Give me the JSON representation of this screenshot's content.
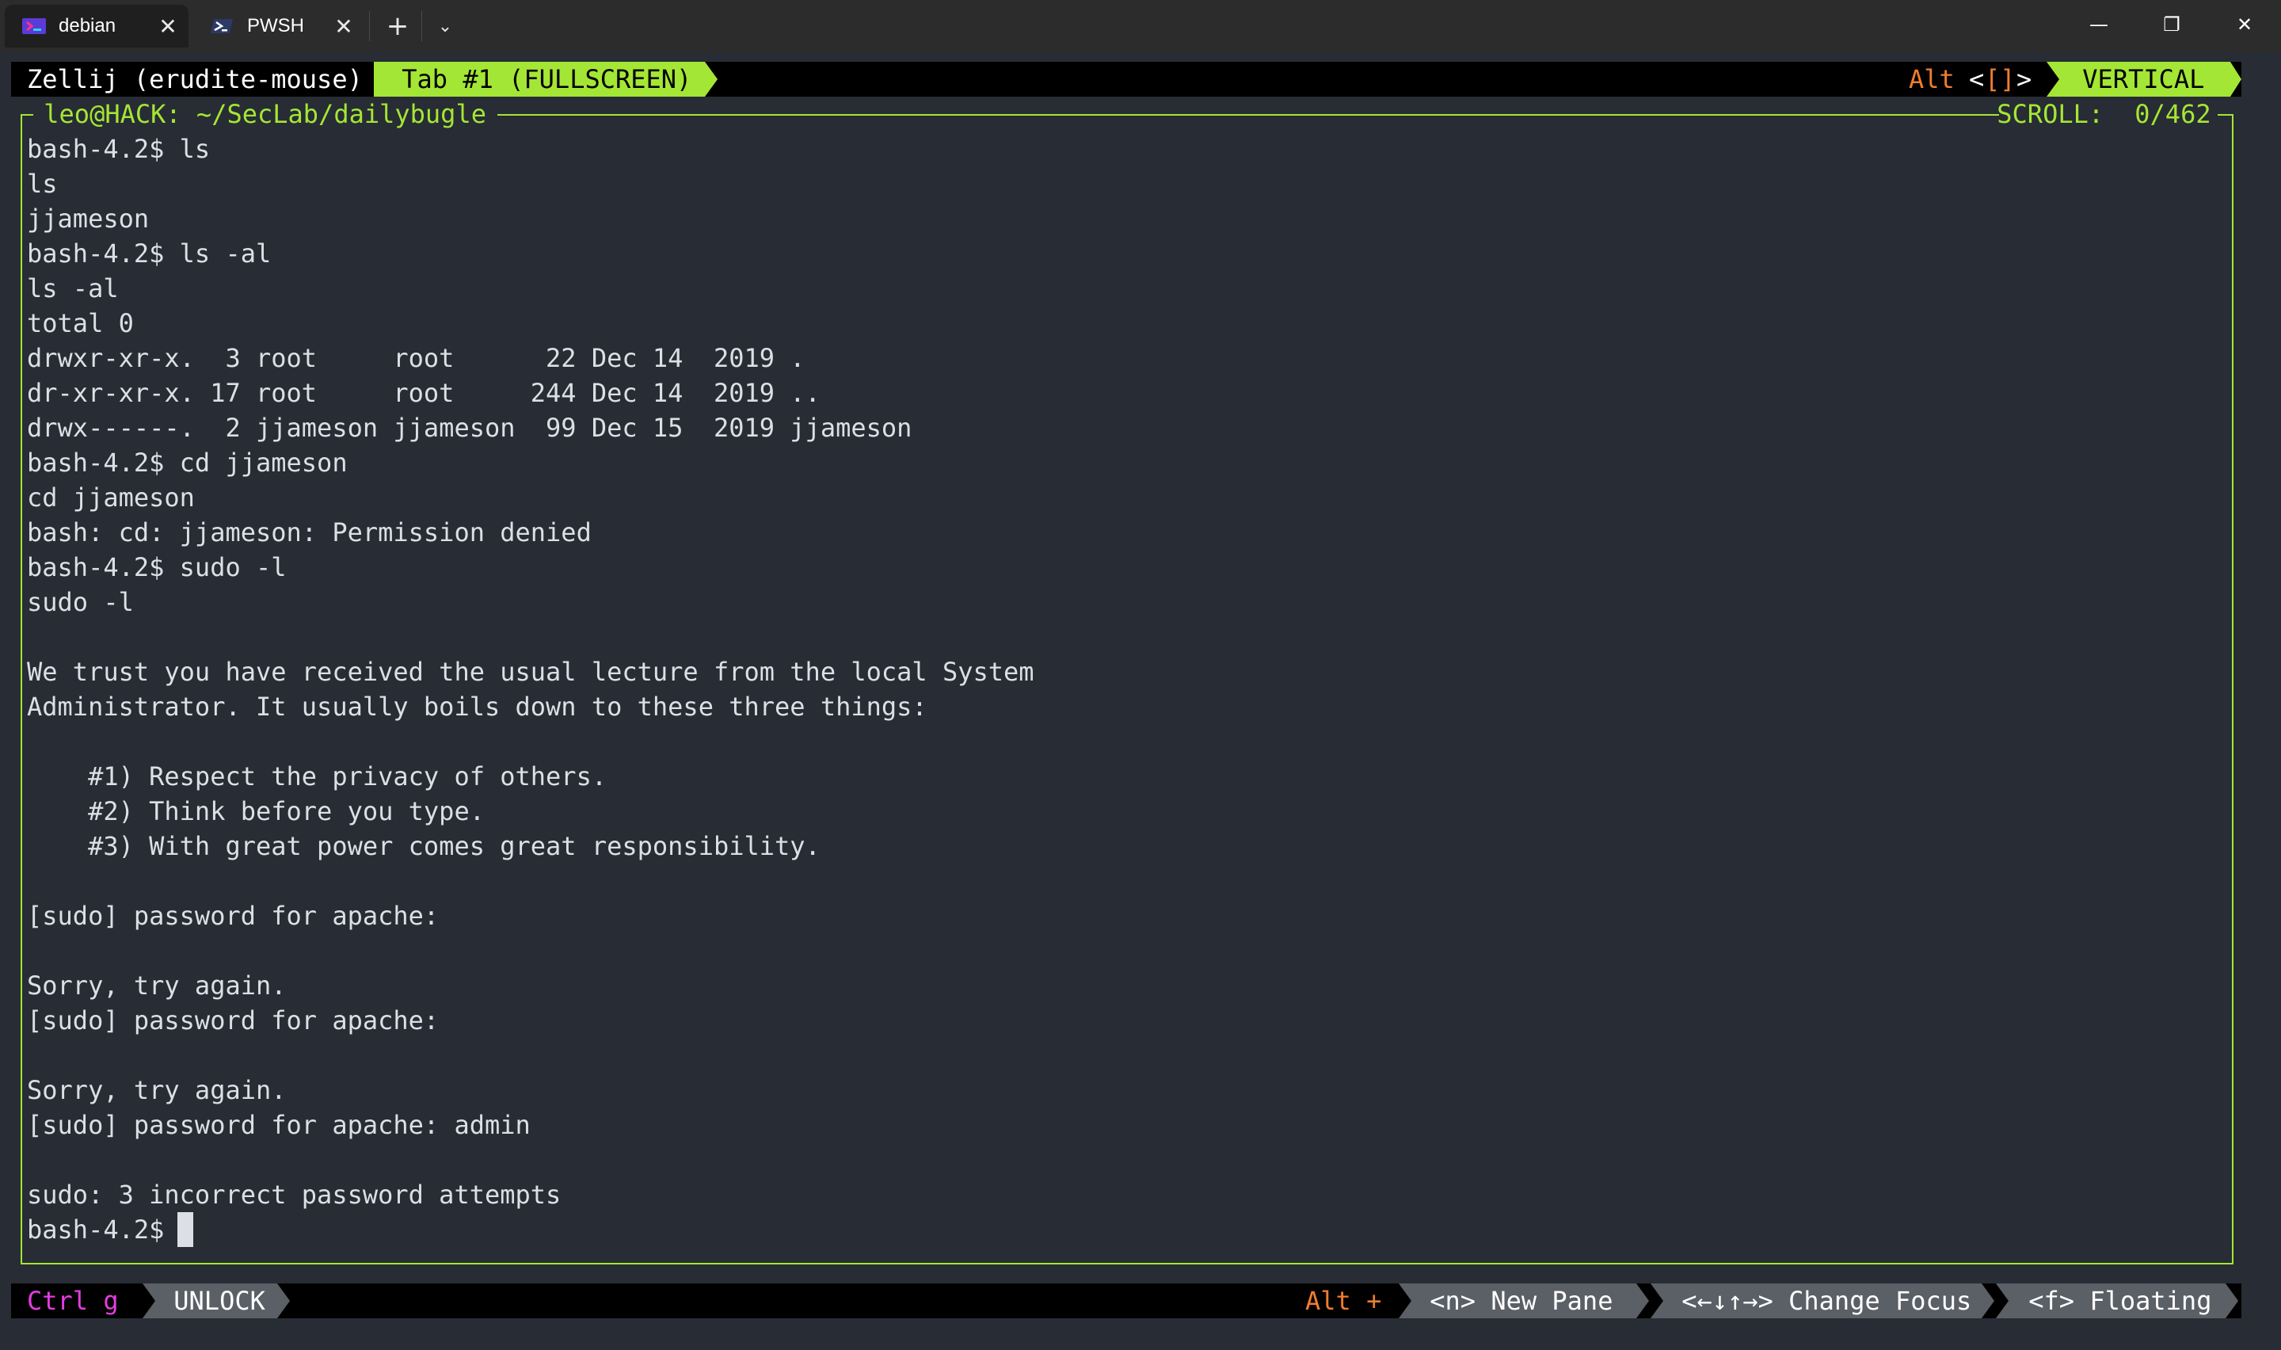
{
  "titlebar": {
    "tabs": [
      {
        "label": "debian",
        "icon": "debian-terminal-icon",
        "active": true
      },
      {
        "label": "PWSH",
        "icon": "powershell-icon",
        "active": false
      }
    ],
    "new_tab": "+",
    "dropdown": "⌄",
    "minimize": "—",
    "maximize": "❐",
    "close": "✕",
    "tab_close": "✕"
  },
  "zellij_top": {
    "session": "Zellij (erudite-mouse) ",
    "tab": " Tab #1 (FULLSCREEN) ",
    "alt_label": "Alt ",
    "alt_keys_open": "<",
    "alt_keys_mid": "[]",
    "alt_keys_close": ">",
    "layout": " VERTICAL "
  },
  "pane": {
    "title": " leo@HACK: ~/SecLab/dailybugle ",
    "scroll_label": " SCROLL: ",
    "scroll_value": " 0/462 "
  },
  "terminal_lines": [
    "bash-4.2$ ls",
    "ls",
    "jjameson",
    "bash-4.2$ ls -al",
    "ls -al",
    "total 0",
    "drwxr-xr-x.  3 root     root      22 Dec 14  2019 .",
    "dr-xr-xr-x. 17 root     root     244 Dec 14  2019 ..",
    "drwx------.  2 jjameson jjameson  99 Dec 15  2019 jjameson",
    "bash-4.2$ cd jjameson",
    "cd jjameson",
    "bash: cd: jjameson: Permission denied",
    "bash-4.2$ sudo -l",
    "sudo -l",
    "",
    "We trust you have received the usual lecture from the local System",
    "Administrator. It usually boils down to these three things:",
    "",
    "    #1) Respect the privacy of others.",
    "    #2) Think before you type.",
    "    #3) With great power comes great responsibility.",
    "",
    "[sudo] password for apache:",
    "",
    "Sorry, try again.",
    "[sudo] password for apache:",
    "",
    "Sorry, try again.",
    "[sudo] password for apache: admin",
    "",
    "sudo: 3 incorrect password attempts",
    "bash-4.2$ "
  ],
  "zellij_bottom": {
    "ctrl_label": "Ctrl g ",
    "mode": " UNLOCK ",
    "alt_label": "Alt + ",
    "hint1": " <n> New Pane ",
    "hint2": " <←↓↑→> Change Focus ",
    "hint3": " <f> Floating "
  },
  "colors": {
    "terminal_bg": "#282c34",
    "fg": "#dcdfe4",
    "accent_green": "#a4e635",
    "orange": "#f07d2e",
    "magenta": "#e33de0",
    "gray_segment": "#5b5f66"
  }
}
